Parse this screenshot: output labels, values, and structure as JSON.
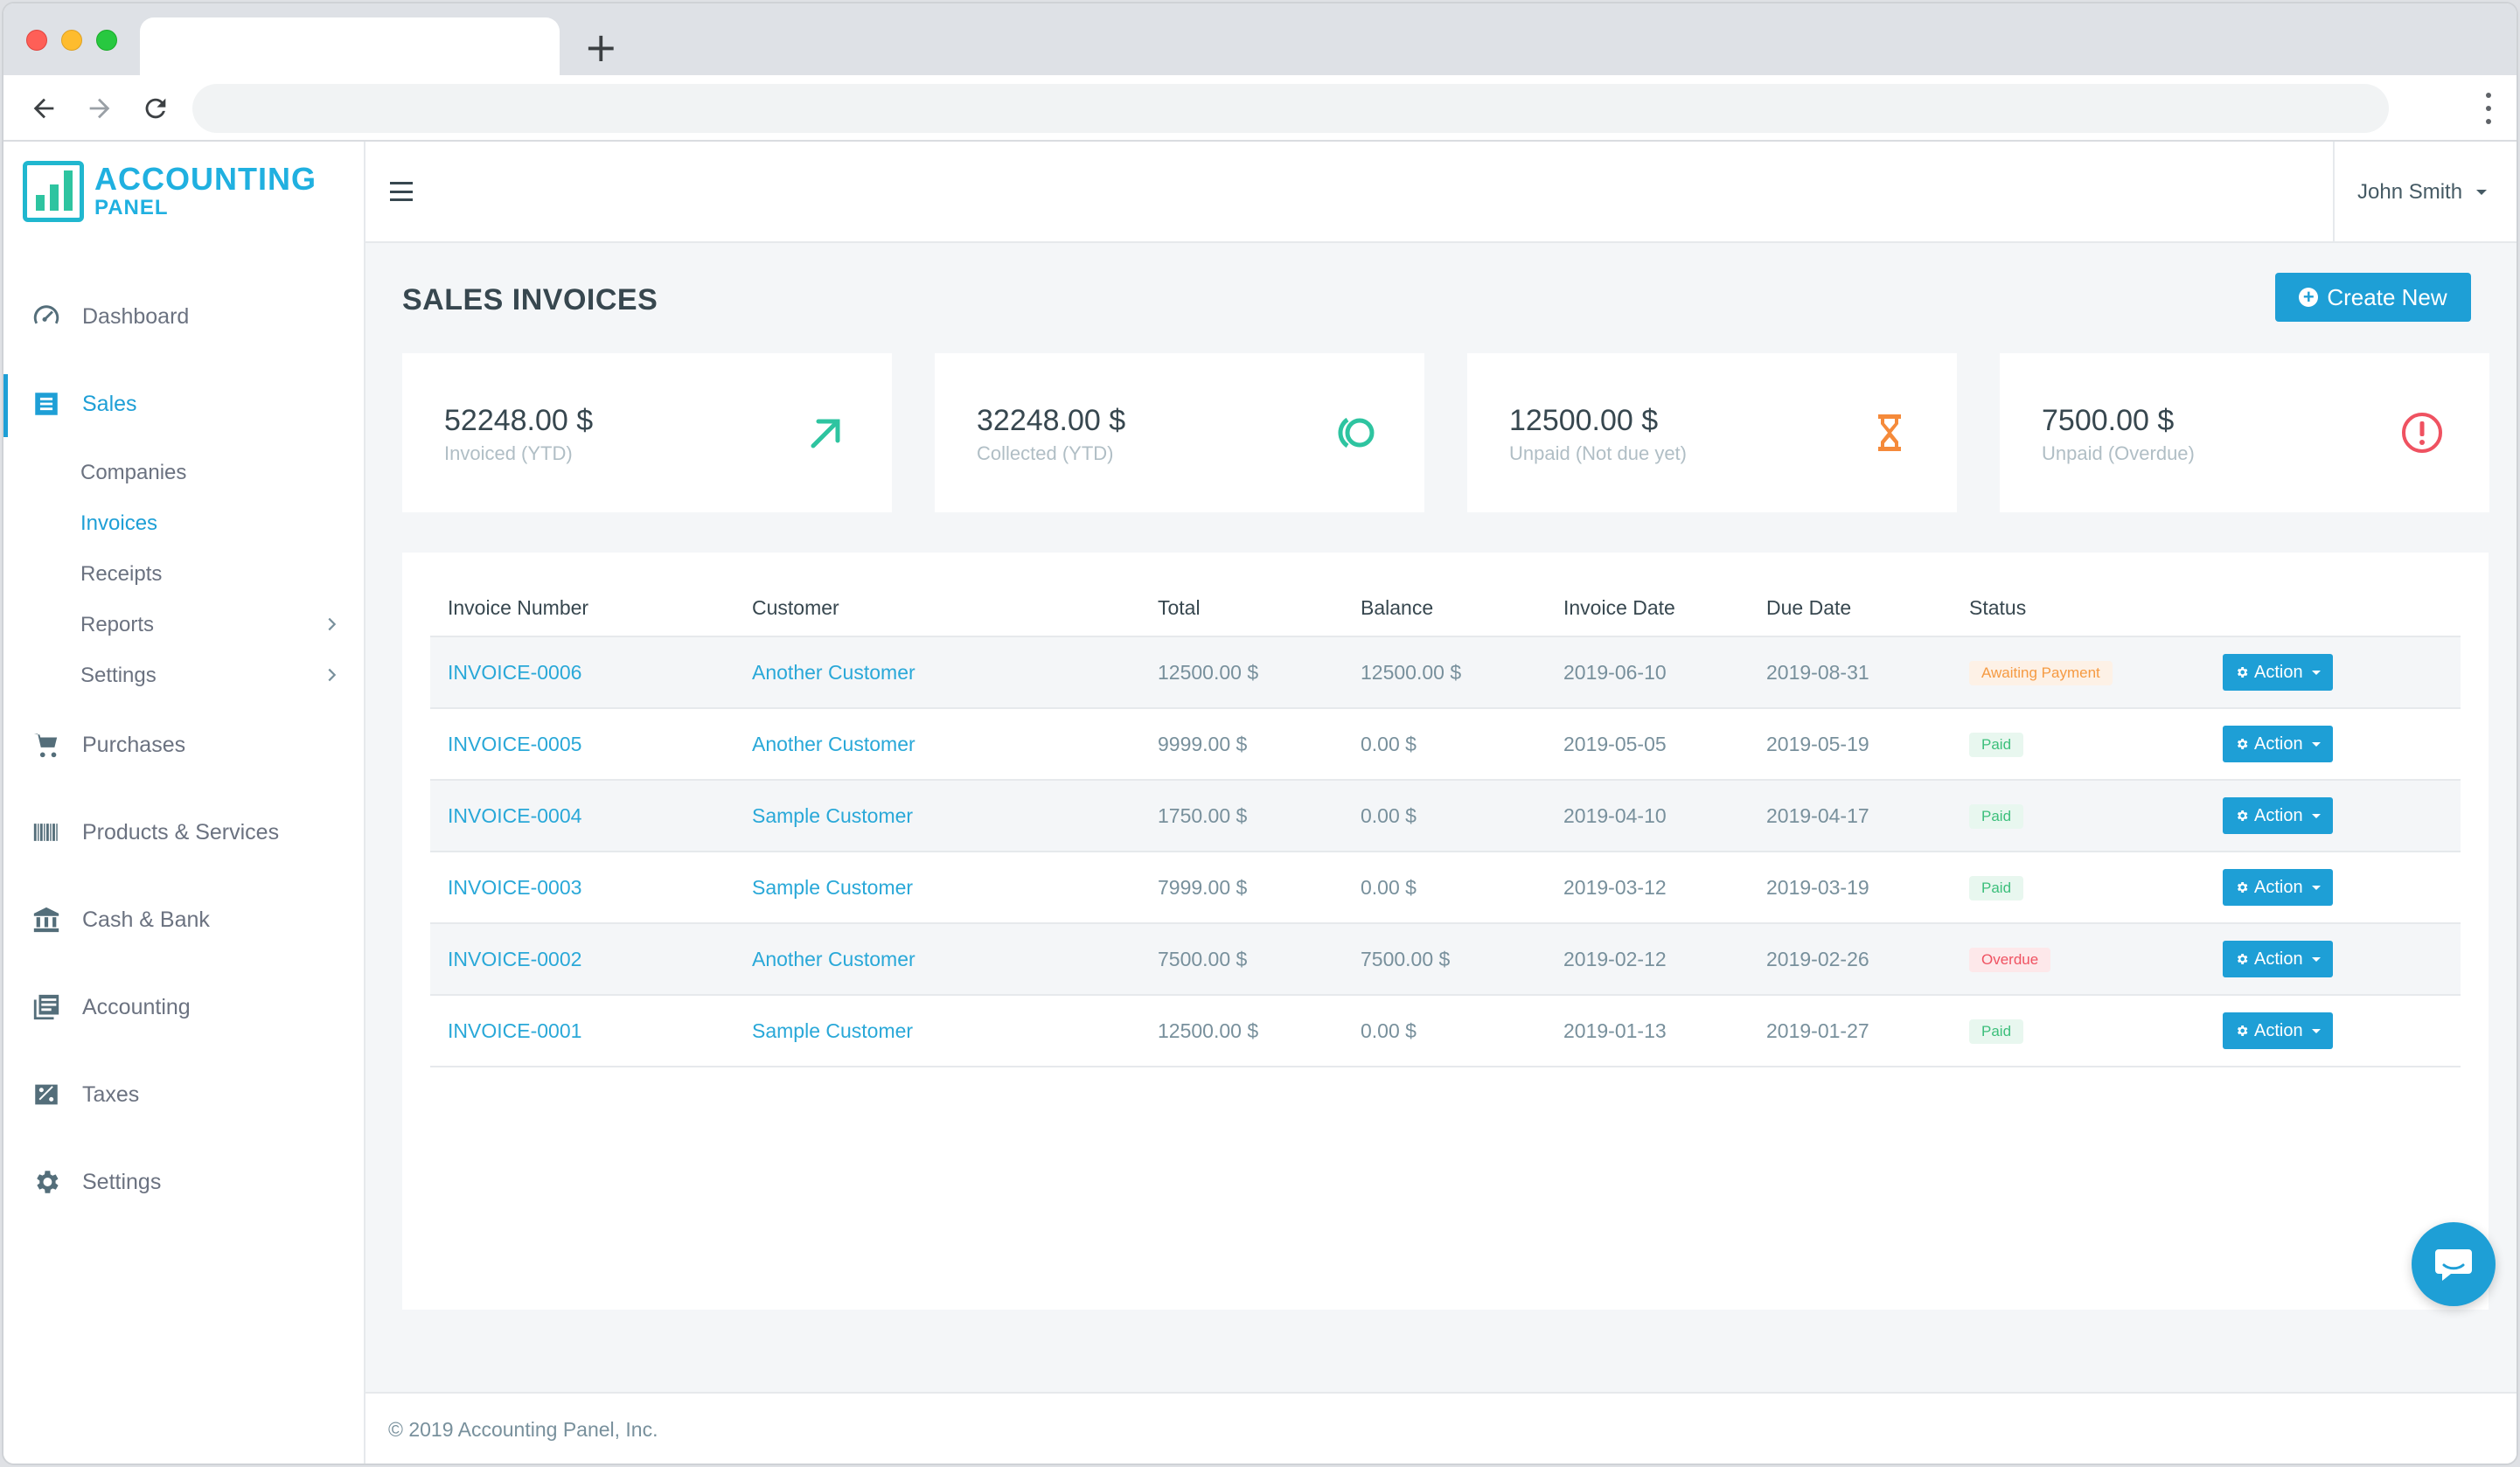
{
  "browser": {
    "address": "",
    "new_tab_label": "+"
  },
  "brand": {
    "line1": "ACCOUNTING",
    "line2": "PANEL",
    "color": "#20b0e0"
  },
  "sidebar": {
    "items": [
      {
        "label": "Dashboard",
        "icon": "gauge-icon"
      },
      {
        "label": "Sales",
        "icon": "list-icon",
        "active": true
      },
      {
        "label": "Purchases",
        "icon": "cart-icon"
      },
      {
        "label": "Products & Services",
        "icon": "barcode-icon"
      },
      {
        "label": "Cash & Bank",
        "icon": "bank-icon"
      },
      {
        "label": "Accounting",
        "icon": "ledger-icon"
      },
      {
        "label": "Taxes",
        "icon": "percent-icon"
      },
      {
        "label": "Settings",
        "icon": "gear-icon"
      }
    ],
    "sales_sub": [
      {
        "label": "Companies"
      },
      {
        "label": "Invoices",
        "active": true
      },
      {
        "label": "Receipts"
      },
      {
        "label": "Reports",
        "has_children": true
      },
      {
        "label": "Settings",
        "has_children": true
      }
    ]
  },
  "topbar": {
    "user_name": "John Smith"
  },
  "page": {
    "title": "SALES INVOICES",
    "create_label": "Create New"
  },
  "cards": [
    {
      "amount": "52248.00 $",
      "label": "Invoiced (YTD)",
      "icon": "arrow-up-right-icon",
      "color": "#2ec4a0"
    },
    {
      "amount": "32248.00 $",
      "label": "Collected (YTD)",
      "icon": "circle-collect-icon",
      "color": "#2ec4a0"
    },
    {
      "amount": "12500.00 $",
      "label": "Unpaid (Not due yet)",
      "icon": "hourglass-icon",
      "color": "#f58a3a"
    },
    {
      "amount": "7500.00 $",
      "label": "Unpaid (Overdue)",
      "icon": "alert-circle-icon",
      "color": "#ef5261"
    }
  ],
  "table": {
    "headers": [
      "Invoice Number",
      "Customer",
      "Total",
      "Balance",
      "Invoice Date",
      "Due Date",
      "Status",
      ""
    ],
    "action_label": "Action",
    "rows": [
      {
        "number": "INVOICE-0006",
        "customer": "Another Customer",
        "total": "12500.00 $",
        "balance": "12500.00 $",
        "invoice_date": "2019-06-10",
        "due_date": "2019-08-31",
        "status": "Awaiting Payment",
        "status_type": "awaiting"
      },
      {
        "number": "INVOICE-0005",
        "customer": "Another Customer",
        "total": "9999.00 $",
        "balance": "0.00 $",
        "invoice_date": "2019-05-05",
        "due_date": "2019-05-19",
        "status": "Paid",
        "status_type": "paid"
      },
      {
        "number": "INVOICE-0004",
        "customer": "Sample Customer",
        "total": "1750.00 $",
        "balance": "0.00 $",
        "invoice_date": "2019-04-10",
        "due_date": "2019-04-17",
        "status": "Paid",
        "status_type": "paid"
      },
      {
        "number": "INVOICE-0003",
        "customer": "Sample Customer",
        "total": "7999.00 $",
        "balance": "0.00 $",
        "invoice_date": "2019-03-12",
        "due_date": "2019-03-19",
        "status": "Paid",
        "status_type": "paid"
      },
      {
        "number": "INVOICE-0002",
        "customer": "Another Customer",
        "total": "7500.00 $",
        "balance": "7500.00 $",
        "invoice_date": "2019-02-12",
        "due_date": "2019-02-26",
        "status": "Overdue",
        "status_type": "overdue"
      },
      {
        "number": "INVOICE-0001",
        "customer": "Sample Customer",
        "total": "12500.00 $",
        "balance": "0.00 $",
        "invoice_date": "2019-01-13",
        "due_date": "2019-01-27",
        "status": "Paid",
        "status_type": "paid"
      }
    ]
  },
  "footer": {
    "text": "© 2019 Accounting Panel, Inc."
  }
}
